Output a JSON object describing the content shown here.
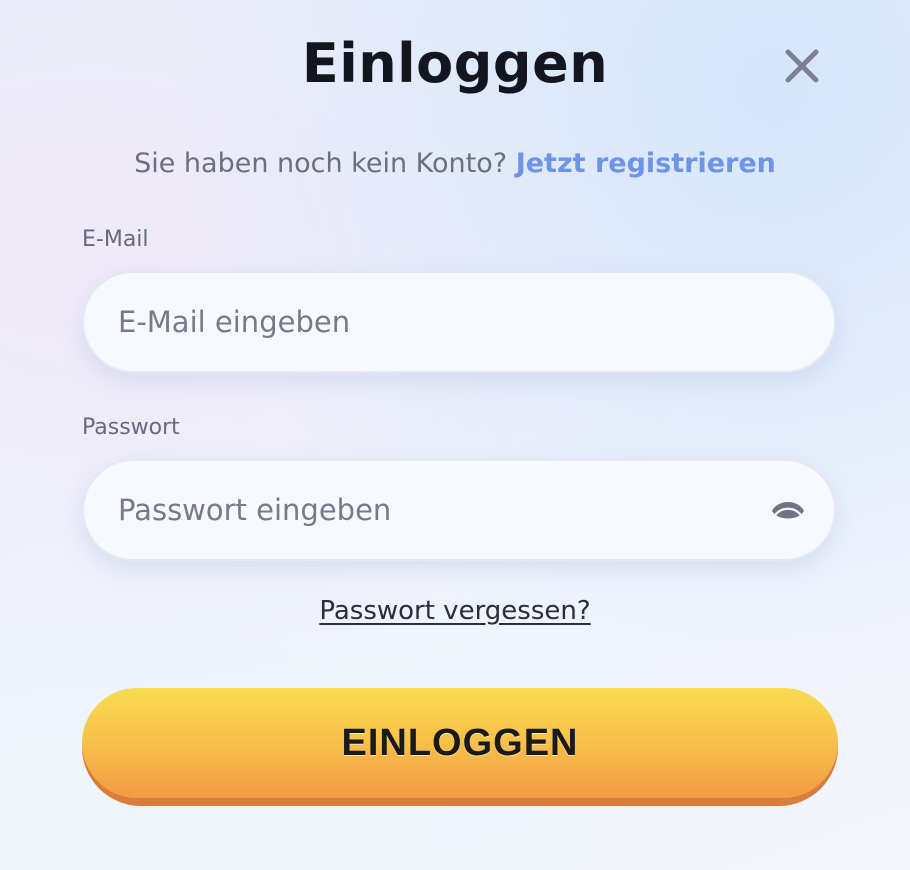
{
  "modal": {
    "title": "Einloggen",
    "close_icon": "close-icon"
  },
  "register_prompt": {
    "text": "Sie haben noch kein Konto? ",
    "link": "Jetzt registrieren"
  },
  "email": {
    "label": "E-Mail",
    "placeholder": "E-Mail eingeben",
    "value": ""
  },
  "password": {
    "label": "Passwort",
    "placeholder": "Passwort eingeben",
    "value": "",
    "toggle_icon": "eye-icon"
  },
  "forgot_password": "Passwort vergessen?",
  "login_button": "EINLOGGEN",
  "colors": {
    "link": "#6f93e8",
    "button_top": "#f9dc52",
    "button_bottom": "#f29a45",
    "button_shadow": "#d97d3a"
  }
}
